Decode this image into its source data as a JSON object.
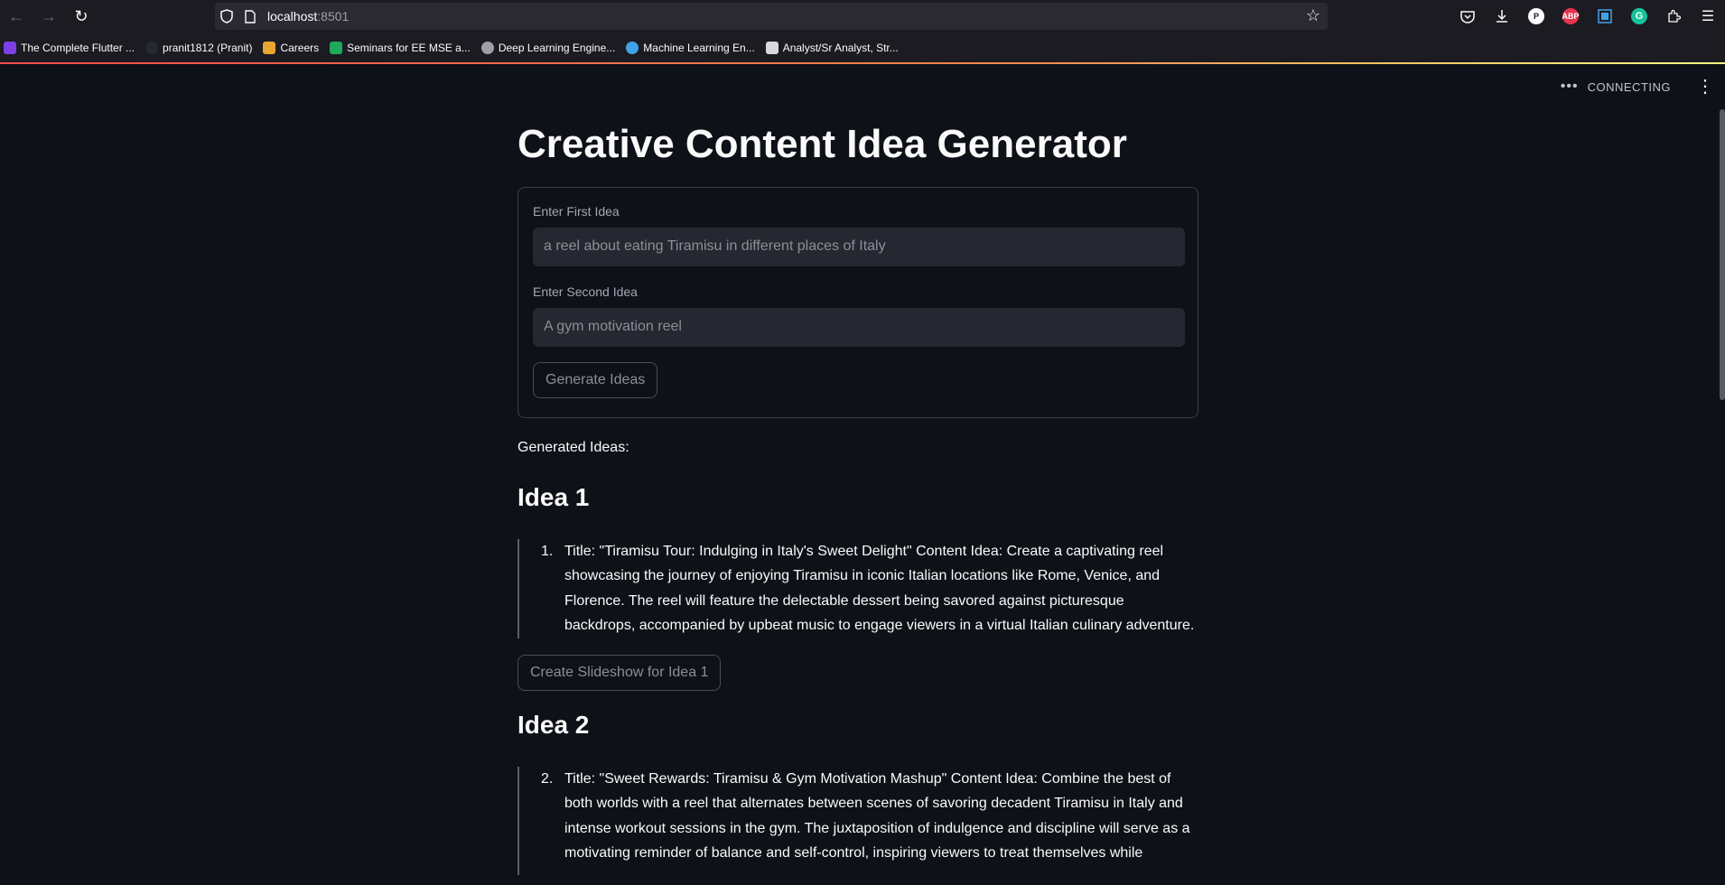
{
  "browser": {
    "url_host": "localhost",
    "url_port": ":8501",
    "bookmarks": [
      {
        "label": "The Complete Flutter ...",
        "color": "#7b3fe4"
      },
      {
        "label": "pranit1812 (Pranit)",
        "color": "#24292e"
      },
      {
        "label": "Careers",
        "color": "#e8a530"
      },
      {
        "label": "Seminars for EE MSE a...",
        "color": "#1ea85b"
      },
      {
        "label": "Deep Learning Engine...",
        "color": "#9e9ea6"
      },
      {
        "label": "Machine Learning En...",
        "color": "#3ea3e8"
      },
      {
        "label": "Analyst/Sr Analyst, Str...",
        "color": "#d9d9d9"
      }
    ],
    "extensions": {
      "abp": "ABP",
      "p": "P",
      "g": "G"
    }
  },
  "app": {
    "status": "CONNECTING",
    "title": "Creative Content Idea Generator",
    "form": {
      "first_label": "Enter First Idea",
      "first_placeholder": "a reel about eating Tiramisu in different places of Italy",
      "second_label": "Enter Second Idea",
      "second_placeholder": "A gym motivation reel",
      "button": "Generate Ideas"
    },
    "generated_label": "Generated Ideas:",
    "ideas": [
      {
        "heading": "Idea 1",
        "number": "1.",
        "text": "Title: \"Tiramisu Tour: Indulging in Italy's Sweet Delight\" Content Idea: Create a captivating reel showcasing the journey of enjoying Tiramisu in iconic Italian locations like Rome, Venice, and Florence. The reel will feature the delectable dessert being savored against picturesque backdrops, accompanied by upbeat music to engage viewers in a virtual Italian culinary adventure.",
        "button": "Create Slideshow for Idea 1"
      },
      {
        "heading": "Idea 2",
        "number": "2.",
        "text": "Title: \"Sweet Rewards: Tiramisu & Gym Motivation Mashup\" Content Idea: Combine the best of both worlds with a reel that alternates between scenes of savoring decadent Tiramisu in Italy and intense workout sessions in the gym. The juxtaposition of indulgence and discipline will serve as a motivating reminder of balance and self-control, inspiring viewers to treat themselves while"
      }
    ]
  }
}
